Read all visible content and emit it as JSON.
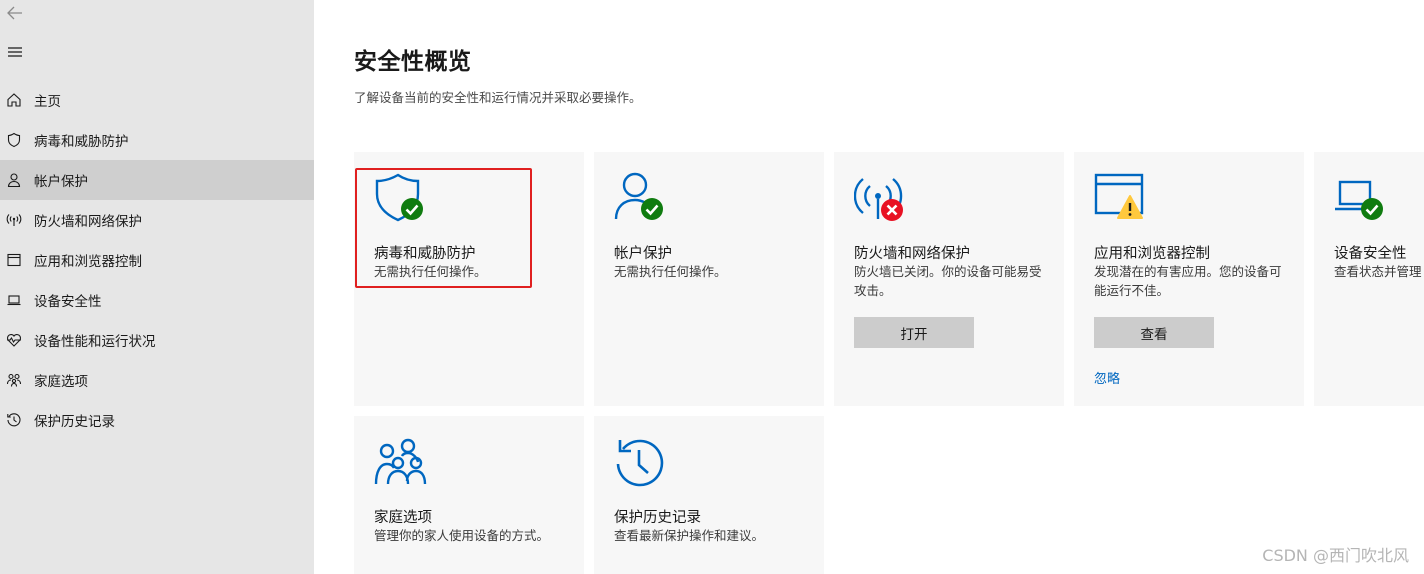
{
  "sidebar": {
    "back_icon": "arrow-left-icon",
    "menu_icon": "hamburger-icon",
    "items": [
      {
        "label": "主页",
        "icon": "home-icon"
      },
      {
        "label": "病毒和威胁防护",
        "icon": "shield-icon"
      },
      {
        "label": "帐户保护",
        "icon": "person-icon",
        "active": true
      },
      {
        "label": "防火墙和网络保护",
        "icon": "wifi-antenna-icon"
      },
      {
        "label": "应用和浏览器控制",
        "icon": "app-window-icon"
      },
      {
        "label": "设备安全性",
        "icon": "laptop-icon"
      },
      {
        "label": "设备性能和运行状况",
        "icon": "heart-pulse-icon"
      },
      {
        "label": "家庭选项",
        "icon": "family-icon"
      },
      {
        "label": "保护历史记录",
        "icon": "history-icon"
      }
    ]
  },
  "main": {
    "title": "安全性概览",
    "subtitle": "了解设备当前的安全性和运行情况并采取必要操作。",
    "cards": [
      {
        "title": "病毒和威胁防护",
        "desc": "无需执行任何操作。",
        "icon": "shield-check-icon",
        "status": "ok"
      },
      {
        "title": "帐户保护",
        "desc": "无需执行任何操作。",
        "icon": "person-check-icon",
        "status": "ok"
      },
      {
        "title": "防火墙和网络保护",
        "desc": "防火墙已关闭。你的设备可能易受攻击。",
        "icon": "antenna-error-icon",
        "status": "error",
        "button": "打开"
      },
      {
        "title": "应用和浏览器控制",
        "desc": "发现潜在的有害应用。您的设备可能运行不佳。",
        "icon": "window-warning-icon",
        "status": "warning",
        "button": "查看",
        "link": "忽略"
      },
      {
        "title": "设备安全性",
        "desc": "查看状态并管理",
        "icon": "laptop-check-icon",
        "status": "ok"
      },
      {
        "title": "家庭选项",
        "desc": "管理你的家人使用设备的方式。",
        "icon": "family-icon"
      },
      {
        "title": "保护历史记录",
        "desc": "查看最新保护操作和建议。",
        "icon": "history-icon"
      }
    ]
  },
  "colors": {
    "accent": "#0067c0",
    "ok": "#107c10",
    "error": "#e81123",
    "warning": "#ffc83d",
    "highlight": "#e02020"
  },
  "watermark": "CSDN @西门吹北风"
}
